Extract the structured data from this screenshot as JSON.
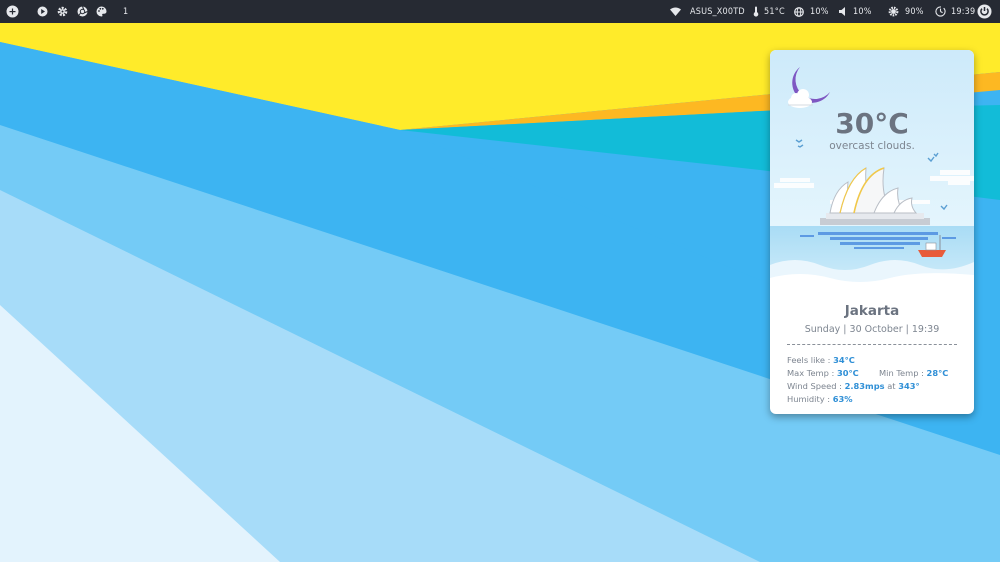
{
  "topbar": {
    "left_icons": [
      "add-circle-icon",
      "play-icon",
      "settings-gear-icon",
      "aperture-icon",
      "palette-icon"
    ],
    "workspace": "1",
    "network_name": "ASUS_X00TD",
    "temperature": "51°C",
    "cpu": "10%",
    "volume": "10%",
    "brightness": "90%",
    "time": "19:39"
  },
  "weather": {
    "temperature": "30°C",
    "description": "overcast clouds.",
    "city": "Jakarta",
    "date": "Sunday | 30 October | 19:39",
    "feels_like_label": "Feels like : ",
    "feels_like": "34°C",
    "max_temp_label": "Max Temp : ",
    "max_temp": "30°C",
    "min_temp_label": "Min Temp : ",
    "min_temp": "28°C",
    "wind_label": "Wind Speed : ",
    "wind_speed": "2.83mps",
    "wind_at": " at ",
    "wind_deg": "343°",
    "humidity_label": "Humidity : ",
    "humidity": "63%"
  },
  "colors": {
    "topbar_bg": "#262a33",
    "accent_blue": "#2f8fd6",
    "moon_purple": "#7e57c2",
    "wallpaper_yellow": "#ffeb2a",
    "wallpaper_orange": "#fdb822",
    "wallpaper_teal": "#12bcd8",
    "wallpaper_blue": "#3db4f2"
  }
}
